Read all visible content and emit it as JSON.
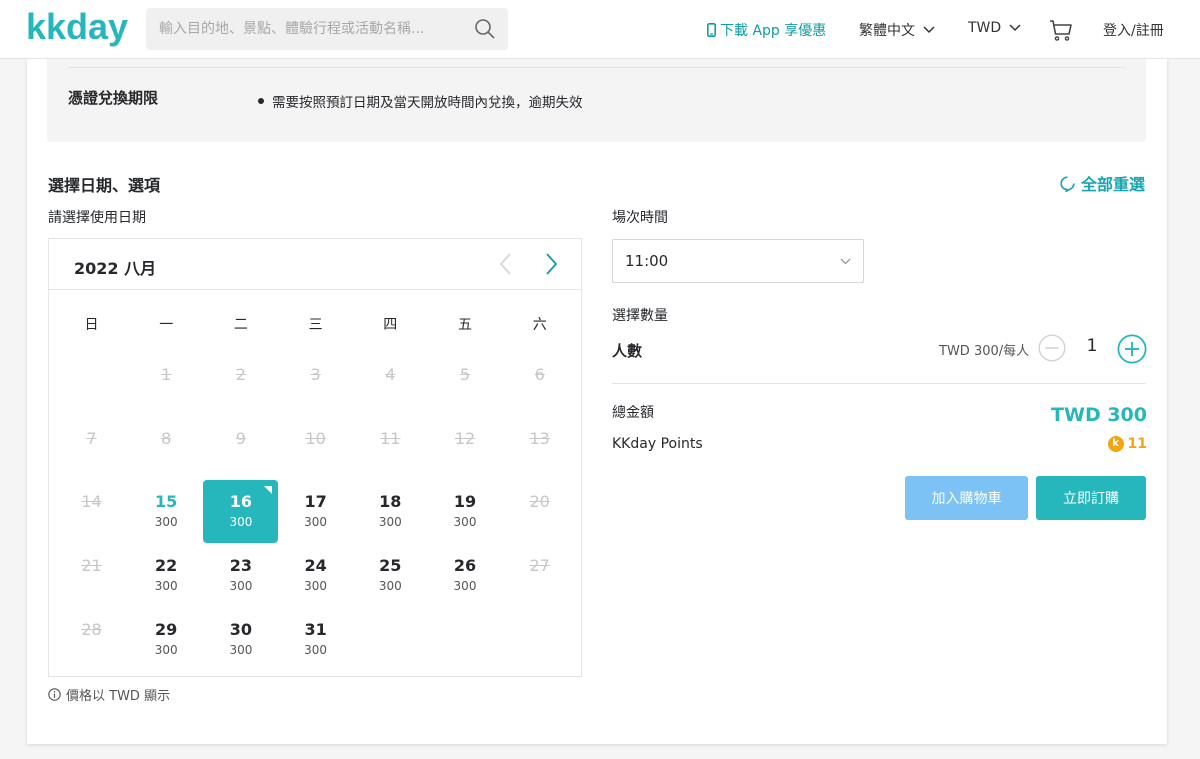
{
  "header": {
    "logo_text": "kkday",
    "search_placeholder": "輸入目的地、景點、體驗行程或活動名稱...",
    "app_promo": "下載 App 享優惠",
    "language": "繁體中文",
    "currency": "TWD",
    "login": "登入/註冊",
    "icons": [
      "search-icon",
      "phone-icon",
      "chevron-down-icon",
      "cart-icon"
    ]
  },
  "voucher": {
    "label": "憑證兌換期限",
    "text": "需要按照預訂日期及當天開放時間內兌換，逾期失效"
  },
  "booking": {
    "title": "選擇日期、選項",
    "reset_label": "全部重選",
    "date_label": "請選擇使用日期",
    "month_label": "2022 八月",
    "weekdays": [
      "日",
      "一",
      "二",
      "三",
      "四",
      "五",
      "六"
    ],
    "days": [
      {
        "d": "1",
        "price": "",
        "state": "disabled"
      },
      {
        "d": "2",
        "price": "",
        "state": "disabled"
      },
      {
        "d": "3",
        "price": "",
        "state": "disabled"
      },
      {
        "d": "4",
        "price": "",
        "state": "disabled"
      },
      {
        "d": "5",
        "price": "",
        "state": "disabled"
      },
      {
        "d": "6",
        "price": "",
        "state": "disabled"
      },
      {
        "d": "7",
        "price": "",
        "state": "disabled"
      },
      {
        "d": "8",
        "price": "",
        "state": "disabled"
      },
      {
        "d": "9",
        "price": "",
        "state": "disabled"
      },
      {
        "d": "10",
        "price": "",
        "state": "disabled"
      },
      {
        "d": "11",
        "price": "",
        "state": "disabled"
      },
      {
        "d": "12",
        "price": "",
        "state": "disabled"
      },
      {
        "d": "13",
        "price": "",
        "state": "disabled"
      },
      {
        "d": "14",
        "price": "",
        "state": "disabled"
      },
      {
        "d": "15",
        "price": "300",
        "state": "today"
      },
      {
        "d": "16",
        "price": "300",
        "state": "selected"
      },
      {
        "d": "17",
        "price": "300",
        "state": "available"
      },
      {
        "d": "18",
        "price": "300",
        "state": "available"
      },
      {
        "d": "19",
        "price": "300",
        "state": "available"
      },
      {
        "d": "20",
        "price": "",
        "state": "disabled"
      },
      {
        "d": "21",
        "price": "",
        "state": "disabled"
      },
      {
        "d": "22",
        "price": "300",
        "state": "available"
      },
      {
        "d": "23",
        "price": "300",
        "state": "available"
      },
      {
        "d": "24",
        "price": "300",
        "state": "available"
      },
      {
        "d": "25",
        "price": "300",
        "state": "available"
      },
      {
        "d": "26",
        "price": "300",
        "state": "available"
      },
      {
        "d": "27",
        "price": "",
        "state": "disabled"
      },
      {
        "d": "28",
        "price": "",
        "state": "disabled"
      },
      {
        "d": "29",
        "price": "300",
        "state": "available"
      },
      {
        "d": "30",
        "price": "300",
        "state": "available"
      },
      {
        "d": "31",
        "price": "300",
        "state": "available"
      }
    ],
    "first_weekday": 1,
    "price_note": "價格以 TWD 顯示",
    "time_label": "場次時間",
    "time_value": "11:00",
    "quantity_label": "選擇數量",
    "pax_label": "人數",
    "unit_price": "TWD 300/每人",
    "quantity": "1",
    "total_label": "總金額",
    "total_value": "TWD 300",
    "points_label": "KKday Points",
    "points_value": "11",
    "points_coin": "k",
    "add_cart_label": "加入購物車",
    "book_now_label": "立即訂購"
  },
  "colors": {
    "accent": "#26b7bc",
    "cart_button": "#7cc2f4",
    "points": "#f2a614",
    "app_link": "#0f9ca6"
  }
}
